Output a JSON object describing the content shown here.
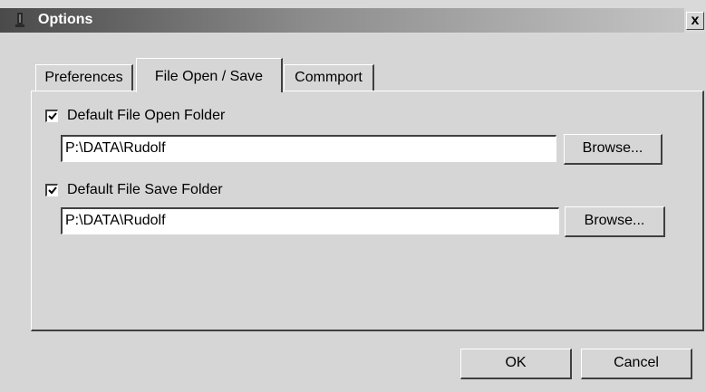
{
  "window": {
    "title": "Options",
    "close_label": "x"
  },
  "tabs": [
    {
      "label": "Preferences",
      "active": false
    },
    {
      "label": "File Open / Save",
      "active": true
    },
    {
      "label": "Commport",
      "active": false
    }
  ],
  "open_folder": {
    "checkbox_label": "Default File Open Folder",
    "checked": true,
    "path": "P:\\DATA\\Rudolf",
    "browse_label": "Browse..."
  },
  "save_folder": {
    "checkbox_label": "Default File Save Folder",
    "checked": true,
    "path": "P:\\DATA\\Rudolf",
    "browse_label": "Browse..."
  },
  "footer": {
    "ok_label": "OK",
    "cancel_label": "Cancel"
  },
  "icons": {
    "app": "app-icon",
    "close": "close-icon",
    "check": "check-icon"
  }
}
